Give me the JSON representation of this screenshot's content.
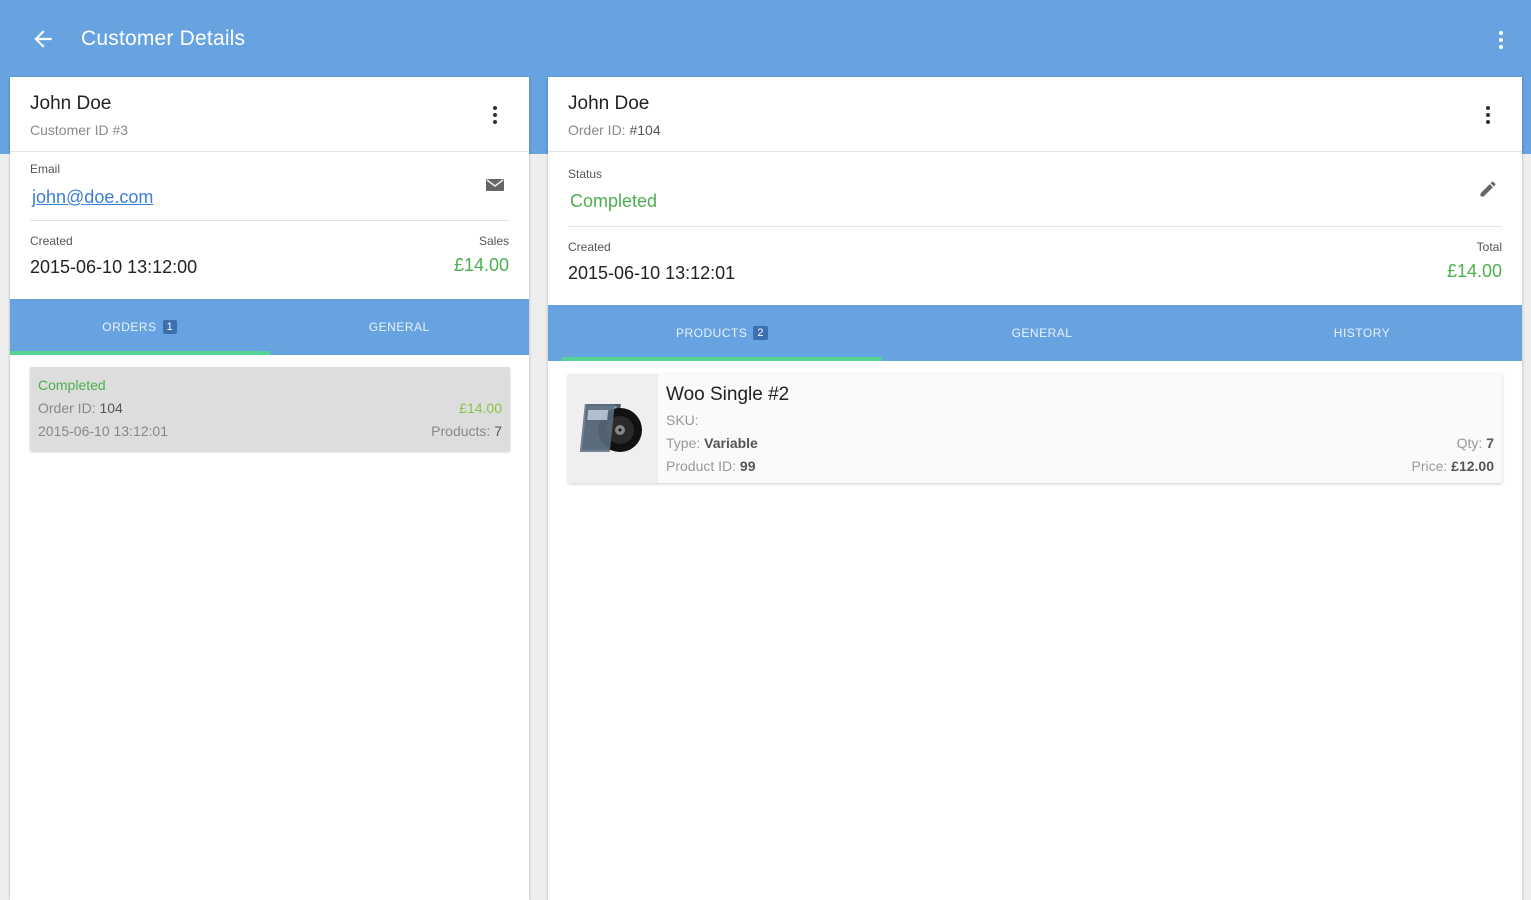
{
  "appbar": {
    "title": "Customer Details",
    "back_icon": "arrow-left-icon",
    "menu_icon": "more-vert-icon"
  },
  "customer": {
    "name": "John Doe",
    "id_label": "Customer ID #3",
    "email_label": "Email",
    "email": "john@doe.com",
    "email_icon": "mail-icon",
    "created_label": "Created",
    "created": "2015-06-10 13:12:00",
    "sales_label": "Sales",
    "sales": "£14.00",
    "tabs": [
      {
        "label": "ORDERS",
        "badge": "1"
      },
      {
        "label": "GENERAL"
      }
    ],
    "orders": [
      {
        "status": "Completed",
        "order_id_label": "Order ID:",
        "order_id": "104",
        "date": "2015-06-10 13:12:01",
        "amount": "£14.00",
        "products_label": "Products:",
        "products": "7"
      }
    ]
  },
  "order": {
    "name": "John Doe",
    "id_label": "Order ID:",
    "id": "#104",
    "status_label": "Status",
    "status": "Completed",
    "edit_icon": "pencil-icon",
    "created_label": "Created",
    "created": "2015-06-10 13:12:01",
    "total_label": "Total",
    "total": "£14.00",
    "tabs": [
      {
        "label": "PRODUCTS",
        "badge": "2"
      },
      {
        "label": "GENERAL"
      },
      {
        "label": "HISTORY"
      }
    ],
    "products": [
      {
        "name": "Woo Single #2",
        "sku_label": "SKU:",
        "type_label": "Type:",
        "type": "Variable",
        "product_id_label": "Product ID:",
        "product_id": "99",
        "qty_label": "Qty:",
        "qty": "7",
        "price_label": "Price:",
        "price": "£12.00",
        "image_icon": "vinyl-record-icon"
      }
    ]
  },
  "colors": {
    "primary": "#66a3e0",
    "accent": "#53d394",
    "success": "#4caf50",
    "link": "#3b7dd8"
  }
}
